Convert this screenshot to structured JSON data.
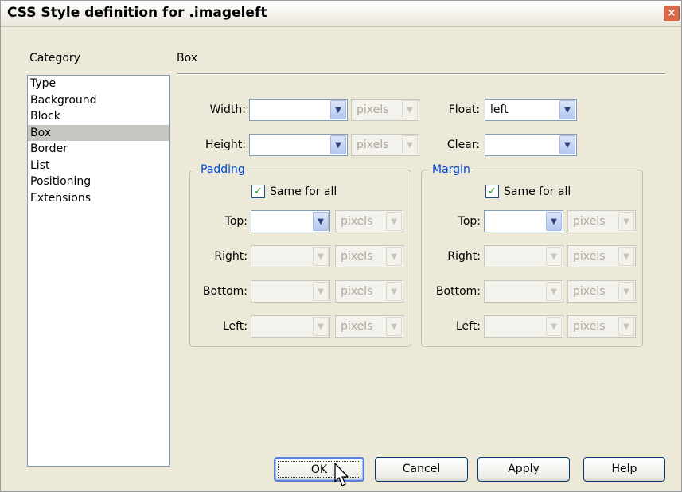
{
  "window": {
    "title": "CSS Style definition for .imageleft",
    "close_glyph": "×"
  },
  "category": {
    "header": "Category",
    "items": [
      "Type",
      "Background",
      "Block",
      "Box",
      "Border",
      "List",
      "Positioning",
      "Extensions"
    ],
    "selected": "Box"
  },
  "section": {
    "title": "Box"
  },
  "box": {
    "width_label": "Width:",
    "width_value": "",
    "width_unit": "pixels",
    "height_label": "Height:",
    "height_value": "",
    "height_unit": "pixels",
    "float_label": "Float:",
    "float_value": "left",
    "clear_label": "Clear:",
    "clear_value": ""
  },
  "padding": {
    "legend": "Padding",
    "same_for_all": "Same for all",
    "same_checked": true,
    "top_label": "Top:",
    "right_label": "Right:",
    "bottom_label": "Bottom:",
    "left_label": "Left:",
    "unit": "pixels"
  },
  "margin": {
    "legend": "Margin",
    "same_for_all": "Same for all",
    "same_checked": true,
    "top_label": "Top:",
    "right_label": "Right:",
    "bottom_label": "Bottom:",
    "left_label": "Left:",
    "unit": "pixels"
  },
  "buttons": {
    "ok": "OK",
    "cancel": "Cancel",
    "apply": "Apply",
    "help": "Help"
  },
  "icons": {
    "dropdown": "chevron-down-icon",
    "check": "checkmark-icon",
    "close": "close-icon",
    "pointer": "mouse-pointer-icon"
  },
  "colors": {
    "dialog_bg": "#ece9d8",
    "group_legend": "#0046d5",
    "selected_item": "#c8c6c0"
  }
}
